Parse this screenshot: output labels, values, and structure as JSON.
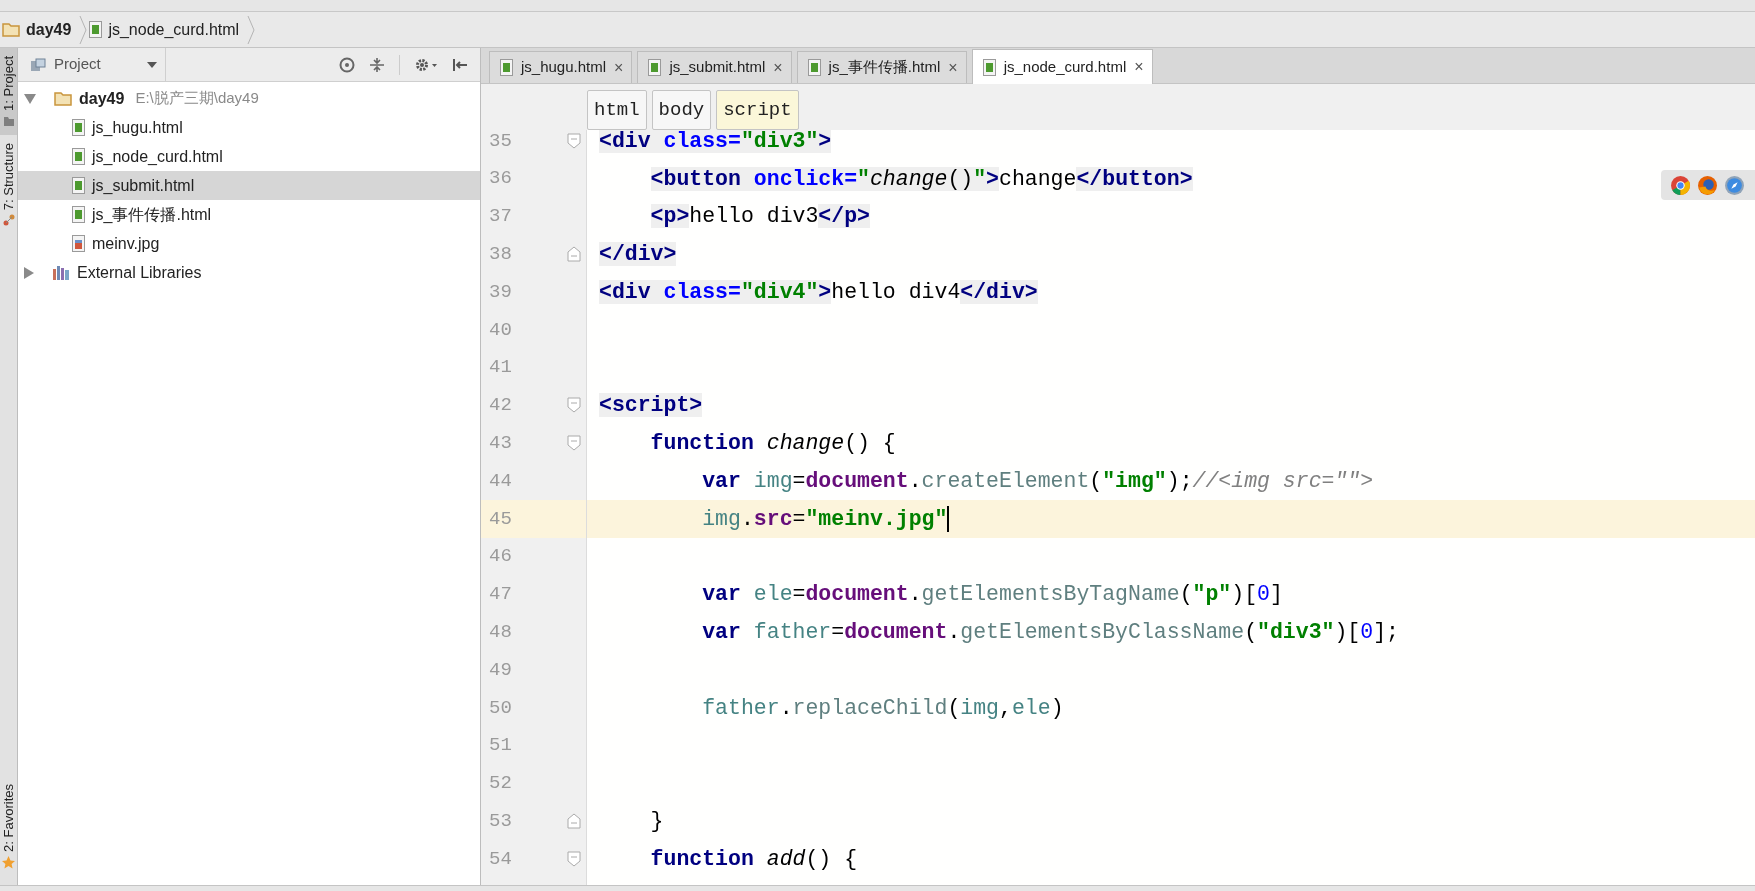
{
  "breadcrumb": [
    {
      "kind": "folder",
      "label": "day49"
    },
    {
      "kind": "file",
      "label": "js_node_curd.html"
    }
  ],
  "tool_windows_top": [
    {
      "label": "1: Project",
      "kind": "project",
      "selected": true
    },
    {
      "label": "7: Structure",
      "kind": "structure",
      "selected": false
    }
  ],
  "tool_windows_bottom": [
    {
      "label": "2: Favorites",
      "kind": "favorites",
      "selected": false
    }
  ],
  "project_panel": {
    "title": "Project",
    "tree": [
      {
        "label": "day49",
        "kind": "folder",
        "path": "E:\\脱产三期\\day49",
        "expanded": true,
        "selected": false,
        "children": [
          {
            "label": "js_hugu.html",
            "kind": "html",
            "selected": false
          },
          {
            "label": "js_node_curd.html",
            "kind": "html",
            "selected": false
          },
          {
            "label": "js_submit.html",
            "kind": "html",
            "selected": true
          },
          {
            "label": "js_事件传播.html",
            "kind": "html",
            "selected": false
          },
          {
            "label": "meinv.jpg",
            "kind": "image",
            "selected": false
          }
        ]
      },
      {
        "label": "External Libraries",
        "kind": "library",
        "expanded": false,
        "selected": false
      }
    ]
  },
  "tabs": [
    {
      "label": "js_hugu.html",
      "close": "×",
      "selected": false
    },
    {
      "label": "js_submit.html",
      "close": "×",
      "selected": false
    },
    {
      "label": "js_事件传播.html",
      "close": "×",
      "selected": false
    },
    {
      "label": "js_node_curd.html",
      "close": "×",
      "selected": true
    }
  ],
  "tag_path": [
    {
      "label": "html",
      "selected": false
    },
    {
      "label": "body",
      "selected": false
    },
    {
      "label": "script",
      "selected": true
    }
  ],
  "code_lines": [
    {
      "number": "35",
      "fold_start": true,
      "fold_end": false,
      "current": false,
      "tokens": [
        {
          "kind": "tag",
          "text": "<div"
        },
        {
          "kind": "attr",
          "text": " class="
        },
        {
          "kind": "hstr",
          "text": "\"div3\""
        },
        {
          "kind": "tag",
          "text": ">"
        }
      ]
    },
    {
      "number": "36",
      "fold_start": false,
      "fold_end": false,
      "current": false,
      "tokens": [
        {
          "kind": "tag",
          "text": "    <button"
        },
        {
          "kind": "attr",
          "text": " onclick="
        },
        {
          "kind": "hstr",
          "text": "\""
        },
        {
          "kind": "hfn",
          "text": "change"
        },
        {
          "kind": "hpunct",
          "text": "()"
        },
        {
          "kind": "hstr",
          "text": "\""
        },
        {
          "kind": "tag",
          "text": ">"
        },
        {
          "kind": "plain",
          "text": "change"
        },
        {
          "kind": "tag",
          "text": "</button>"
        }
      ]
    },
    {
      "number": "37",
      "fold_start": false,
      "fold_end": false,
      "current": false,
      "tokens": [
        {
          "kind": "tag",
          "text": "    <p>"
        },
        {
          "kind": "plain",
          "text": "hello div3"
        },
        {
          "kind": "tag",
          "text": "</p>"
        }
      ]
    },
    {
      "number": "38",
      "fold_start": false,
      "fold_end": true,
      "current": false,
      "tokens": [
        {
          "kind": "tag",
          "text": "</div>"
        }
      ]
    },
    {
      "number": "39",
      "fold_start": false,
      "fold_end": false,
      "current": false,
      "tokens": [
        {
          "kind": "tag",
          "text": "<div"
        },
        {
          "kind": "attr",
          "text": " class="
        },
        {
          "kind": "hstr",
          "text": "\"div4\""
        },
        {
          "kind": "tag",
          "text": ">"
        },
        {
          "kind": "plain",
          "text": "hello div4"
        },
        {
          "kind": "tag",
          "text": "</div>"
        }
      ]
    },
    {
      "number": "40",
      "fold_start": false,
      "fold_end": false,
      "current": false
    },
    {
      "number": "41",
      "fold_start": false,
      "fold_end": false,
      "current": false
    },
    {
      "number": "42",
      "fold_start": true,
      "fold_end": false,
      "current": false,
      "tokens": [
        {
          "kind": "tag",
          "text": "<script>"
        }
      ]
    },
    {
      "number": "43",
      "fold_start": true,
      "fold_end": false,
      "current": false,
      "tokens": [
        {
          "kind": "kw",
          "text": "    function "
        },
        {
          "kind": "fn",
          "text": "change"
        },
        {
          "kind": "plain",
          "text": "() {"
        }
      ]
    },
    {
      "number": "44",
      "fold_start": false,
      "fold_end": false,
      "current": false,
      "tokens": [
        {
          "kind": "kw",
          "text": "        var "
        },
        {
          "kind": "var",
          "text": "img"
        },
        {
          "kind": "plain",
          "text": "="
        },
        {
          "kind": "obj",
          "text": "document"
        },
        {
          "kind": "plain",
          "text": "."
        },
        {
          "kind": "method",
          "text": "createElement"
        },
        {
          "kind": "plain",
          "text": "("
        },
        {
          "kind": "str",
          "text": "\"img\""
        },
        {
          "kind": "plain",
          "text": ");"
        },
        {
          "kind": "comment",
          "text": "//<img src=\"\">"
        }
      ]
    },
    {
      "number": "45",
      "fold_start": false,
      "fold_end": false,
      "current": true,
      "tokens": [
        {
          "kind": "var",
          "text": "        img"
        },
        {
          "kind": "plain",
          "text": "."
        },
        {
          "kind": "obj",
          "text": "src"
        },
        {
          "kind": "plain",
          "text": "="
        },
        {
          "kind": "str",
          "text": "\"meinv.jpg\""
        }
      ]
    },
    {
      "number": "46",
      "fold_start": false,
      "fold_end": false,
      "current": false
    },
    {
      "number": "47",
      "fold_start": false,
      "fold_end": false,
      "current": false,
      "tokens": [
        {
          "kind": "kw",
          "text": "        var "
        },
        {
          "kind": "var",
          "text": "ele"
        },
        {
          "kind": "plain",
          "text": "="
        },
        {
          "kind": "obj",
          "text": "document"
        },
        {
          "kind": "plain",
          "text": "."
        },
        {
          "kind": "method",
          "text": "getElementsByTagName"
        },
        {
          "kind": "plain",
          "text": "("
        },
        {
          "kind": "str",
          "text": "\"p\""
        },
        {
          "kind": "plain",
          "text": ")["
        },
        {
          "kind": "num",
          "text": "0"
        },
        {
          "kind": "plain",
          "text": "]"
        }
      ]
    },
    {
      "number": "48",
      "fold_start": false,
      "fold_end": false,
      "current": false,
      "tokens": [
        {
          "kind": "kw",
          "text": "        var "
        },
        {
          "kind": "var",
          "text": "father"
        },
        {
          "kind": "plain",
          "text": "="
        },
        {
          "kind": "obj",
          "text": "document"
        },
        {
          "kind": "plain",
          "text": "."
        },
        {
          "kind": "method",
          "text": "getElementsByClassName"
        },
        {
          "kind": "plain",
          "text": "("
        },
        {
          "kind": "str",
          "text": "\"div3\""
        },
        {
          "kind": "plain",
          "text": ")["
        },
        {
          "kind": "num",
          "text": "0"
        },
        {
          "kind": "plain",
          "text": "];"
        }
      ]
    },
    {
      "number": "49",
      "fold_start": false,
      "fold_end": false,
      "current": false
    },
    {
      "number": "50",
      "fold_start": false,
      "fold_end": false,
      "current": false,
      "tokens": [
        {
          "kind": "var",
          "text": "        father"
        },
        {
          "kind": "plain",
          "text": "."
        },
        {
          "kind": "method",
          "text": "replaceChild"
        },
        {
          "kind": "plain",
          "text": "("
        },
        {
          "kind": "var",
          "text": "img"
        },
        {
          "kind": "plain",
          "text": ","
        },
        {
          "kind": "var",
          "text": "ele"
        },
        {
          "kind": "plain",
          "text": ")"
        }
      ]
    },
    {
      "number": "51",
      "fold_start": false,
      "fold_end": false,
      "current": false
    },
    {
      "number": "52",
      "fold_start": false,
      "fold_end": false,
      "current": false
    },
    {
      "number": "53",
      "fold_start": false,
      "fold_end": true,
      "current": false,
      "tokens": [
        {
          "kind": "plain",
          "text": "    }"
        }
      ]
    },
    {
      "number": "54",
      "fold_start": true,
      "fold_end": false,
      "current": false,
      "tokens": [
        {
          "kind": "kw",
          "text": "    function "
        },
        {
          "kind": "fn",
          "text": "add"
        },
        {
          "kind": "plain",
          "text": "() {"
        }
      ]
    }
  ]
}
